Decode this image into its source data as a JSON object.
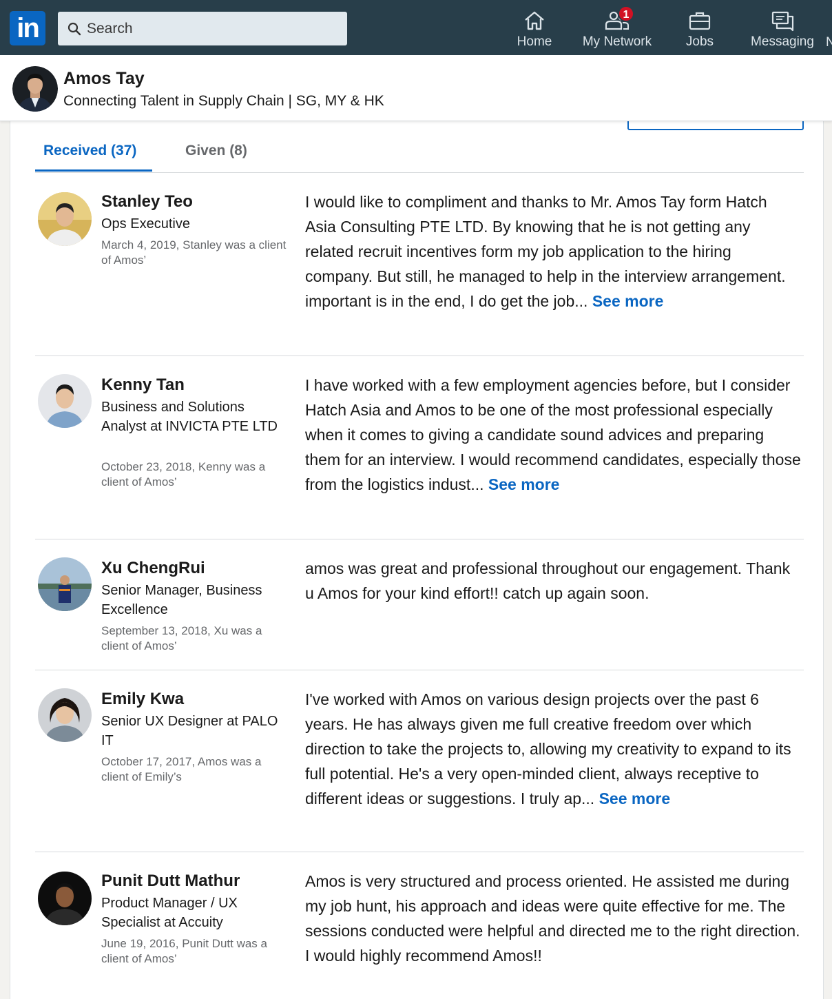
{
  "nav": {
    "logo_text": "in",
    "search_placeholder": "Search",
    "items": [
      {
        "label": "Home",
        "icon": "home-icon"
      },
      {
        "label": "My Network",
        "icon": "network-icon",
        "badge": "1"
      },
      {
        "label": "Jobs",
        "icon": "briefcase-icon"
      },
      {
        "label": "Messaging",
        "icon": "messaging-icon"
      }
    ],
    "overflow_label": "N",
    "brand_color": "#0a66c2",
    "nav_bg": "#283e4a"
  },
  "profile": {
    "name": "Amos Tay",
    "headline": "Connecting Talent in Supply Chain | SG, MY & HK"
  },
  "tabs": [
    {
      "label": "Received (37)",
      "active": true
    },
    {
      "label": "Given (8)",
      "active": false
    }
  ],
  "recommendations": [
    {
      "name": "Stanley Teo",
      "title": "Ops Executive",
      "meta": "March 4, 2019, Stanley was a client of Amos’",
      "text": "I would like to compliment and thanks to Mr. Amos Tay form Hatch Asia Consulting PTE LTD. By knowing that he is not getting any related recruit incentives form my job application to the hiring company. But still, he managed to help in the interview arrangement. important is in the end, I do get the job... ",
      "see_more": "See more"
    },
    {
      "name": "Kenny Tan",
      "title": "Business and Solutions Analyst at INVICTA PTE LTD",
      "meta": "October 23, 2018, Kenny was a client of Amos’",
      "text": "I have worked with a few employment agencies before, but I consider Hatch Asia and Amos to be one of the most professional especially when it comes to giving a candidate sound advices and preparing them for an interview. I would recommend candidates, especially those from the logistics indust... ",
      "see_more": "See more"
    },
    {
      "name": "Xu ChengRui",
      "title": "Senior Manager, Business Excellence",
      "meta": "September 13, 2018, Xu was a client of Amos’",
      "text": "amos was great and professional throughout our engagement. Thank u Amos for your kind effort!! catch up again soon.",
      "see_more": ""
    },
    {
      "name": "Emily Kwa",
      "title": "Senior UX Designer at PALO IT",
      "meta": "October 17, 2017, Amos was a client of Emily’s",
      "text": "I've worked with Amos on various design projects over the past 6 years. He has always given me full creative freedom over which direction to take the projects to, allowing my creativity to expand to its full potential. He's a very open-minded client, always receptive to different ideas or suggestions. I truly ap... ",
      "see_more": "See more"
    },
    {
      "name": "Punit Dutt Mathur",
      "title": "Product Manager / UX Specialist at Accuity",
      "meta": "June 19, 2016, Punit Dutt was a client of Amos’",
      "text": "Amos is very structured and process oriented. He assisted me during my job hunt, his approach and ideas were quite effective for me. The sessions conducted were helpful and directed me to the right direction. I would highly recommend Amos!!",
      "see_more": ""
    }
  ]
}
